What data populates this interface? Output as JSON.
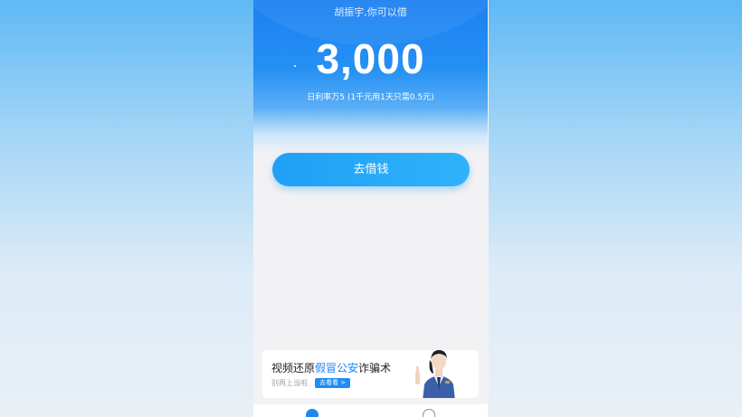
{
  "hero": {
    "greeting": "胡振宇,你可以借",
    "amount": "3,000",
    "rate_text": "日利率万5 (1千元用1天只需0.5元)"
  },
  "borrow_button_label": "去借钱",
  "banner": {
    "title_prefix": "视频还原",
    "title_highlight": "假冒公安",
    "title_suffix": "诈骗术",
    "subtitle": "别再上当啦",
    "cta_label": "去看看 >"
  },
  "colors": {
    "primary": "#1c80f2",
    "button": "#1fa0f5",
    "highlight": "#1b82f0"
  },
  "icons": {
    "home_tab": "home-icon",
    "message_tab": "message-icon"
  }
}
